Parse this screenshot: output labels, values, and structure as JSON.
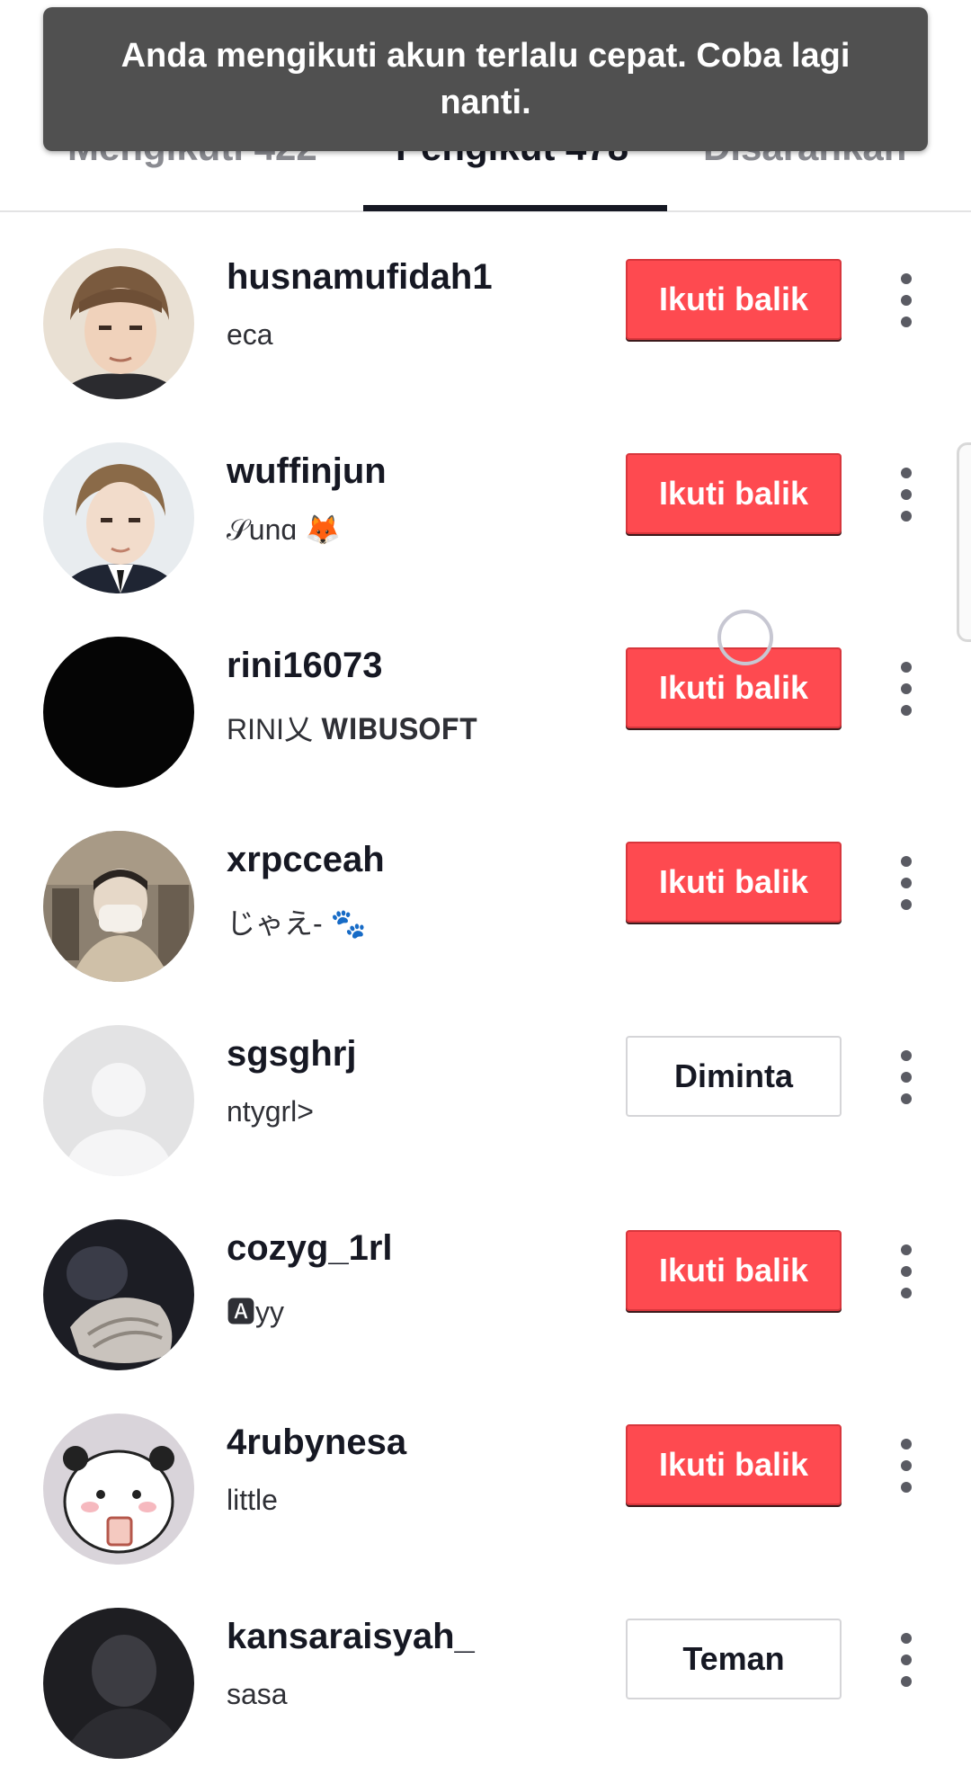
{
  "toast": {
    "message": "Anda mengikuti akun terlalu cepat. Coba lagi nanti."
  },
  "tabs": [
    {
      "label": "Mengikuti 422"
    },
    {
      "label": "Pengikut 478"
    },
    {
      "label": "Disarankan"
    }
  ],
  "colors": {
    "follow_button": "#fe4a50",
    "toast_background": "#505050"
  },
  "rows": [
    {
      "username": "husnamufidah1",
      "nickname": "eca",
      "button": "Ikuti balik",
      "button_style": "follow",
      "avatar": "photo-male-portrait"
    },
    {
      "username": "wuffinjun",
      "nickname": "𝒮unɑ 🦊",
      "button": "Ikuti balik",
      "button_style": "follow",
      "avatar": "photo-suit-portrait"
    },
    {
      "username": "rini16073",
      "nickname": "RINI乂 𝐖𝐈𝐁𝐔𝐒𝐎𝐅𝐓",
      "button": "Ikuti balik",
      "button_style": "follow",
      "avatar": "black"
    },
    {
      "username": "xrpcceah",
      "nickname": "じゃえ- 🐾",
      "button": "Ikuti balik",
      "button_style": "follow",
      "avatar": "photo-masked"
    },
    {
      "username": "sgsghrj",
      "nickname": "ntygrl>",
      "button": "Diminta",
      "button_style": "outline",
      "avatar": "default-person-icon"
    },
    {
      "username": "cozyg_1rl",
      "nickname": "🅰yy",
      "button": "Ikuti balik",
      "button_style": "follow",
      "avatar": "photo-dark"
    },
    {
      "username": "4rubynesa",
      "nickname": "little",
      "button": "Ikuti balik",
      "button_style": "follow",
      "avatar": "cartoon-panda"
    },
    {
      "username": "kansaraisyah_",
      "nickname": "sasa",
      "button": "Teman",
      "button_style": "outline",
      "avatar": "photo-dark-bw"
    }
  ]
}
